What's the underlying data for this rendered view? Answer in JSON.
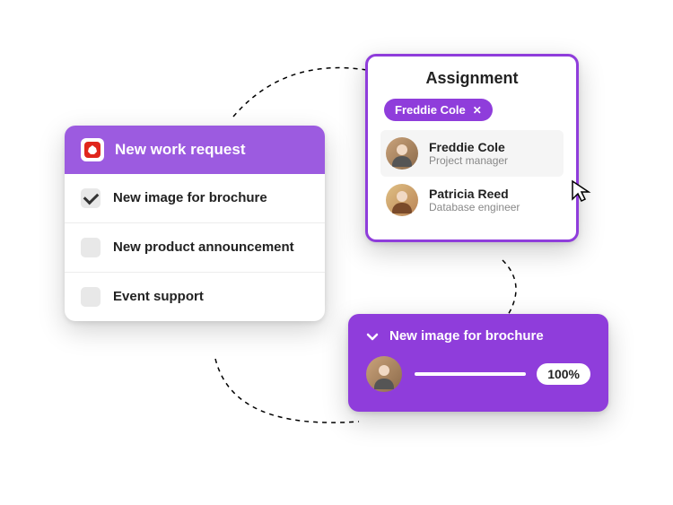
{
  "colors": {
    "accent": "#8f3ddb",
    "accent_light": "#9c5be0",
    "app_red": "#e0261c"
  },
  "request": {
    "title": "New work request",
    "items": [
      {
        "label": "New image for brochure",
        "checked": true
      },
      {
        "label": "New product announcement",
        "checked": false
      },
      {
        "label": "Event support",
        "checked": false
      }
    ]
  },
  "assignment": {
    "title": "Assignment",
    "chip": {
      "label": "Freddie Cole"
    },
    "people": [
      {
        "name": "Freddie Cole",
        "role": "Project manager",
        "selected": true
      },
      {
        "name": "Patricia Reed",
        "role": "Database engineer",
        "selected": false
      }
    ]
  },
  "progress": {
    "title": "New image for brochure",
    "percent": "100%"
  }
}
